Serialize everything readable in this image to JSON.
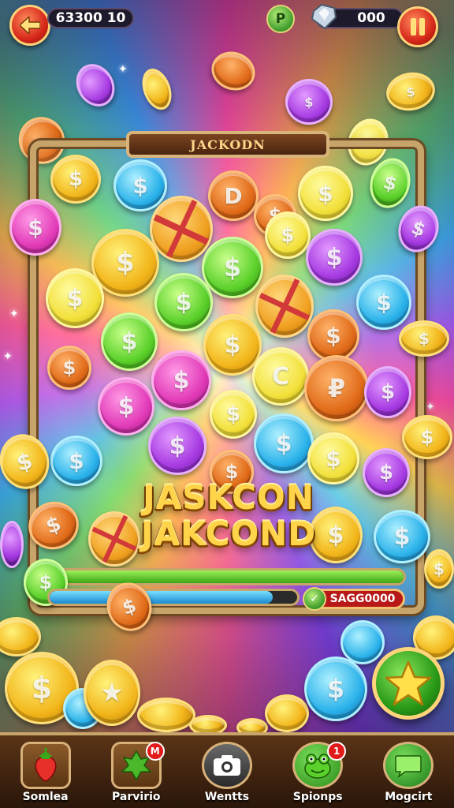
{
  "top_bar": {
    "score": "63300 10",
    "gem_count": "000"
  },
  "board": {
    "title": "JACKODN",
    "jackpot_line1": "JASKCON",
    "jackpot_line2": "JAKCOND",
    "coin_symbol": "$"
  },
  "progress": {
    "bar1_fill": 1.0,
    "bar2_fill": 0.9,
    "reward_label": "SAGG0000"
  },
  "bottom_nav": {
    "items": [
      {
        "label": "Somlea",
        "icon": "strawberry-icon",
        "badge": ""
      },
      {
        "label": "Parvirio",
        "icon": "leaf-icon",
        "badge": "M"
      },
      {
        "label": "Wentts",
        "icon": "camera-icon",
        "badge": ""
      },
      {
        "label": "Spionps",
        "icon": "frog-icon",
        "badge": "1"
      },
      {
        "label": "Mogcirt",
        "icon": "chat-icon",
        "badge": ""
      }
    ]
  },
  "colors": {
    "frame": "#c7a46a",
    "accent_red": "#d6281a",
    "progress_green": "#3aa614",
    "progress_blue": "#1a8ad0"
  }
}
